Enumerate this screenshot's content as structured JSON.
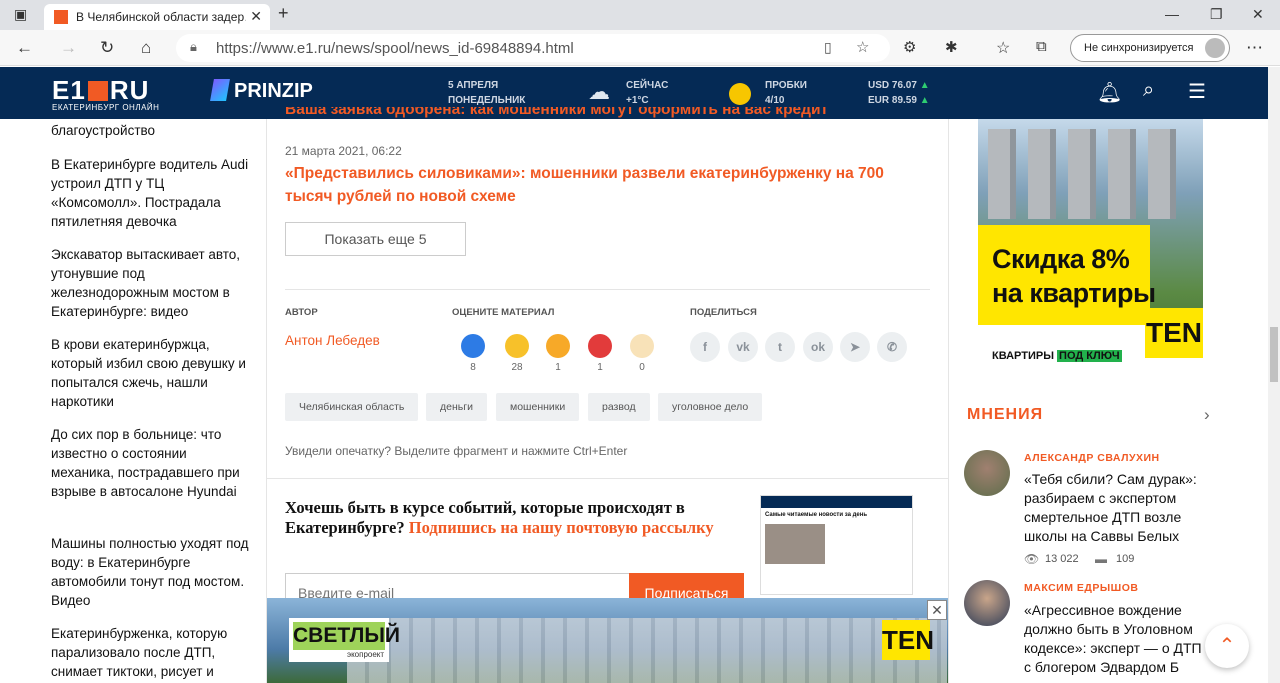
{
  "browser": {
    "tab_title": "В Челябинской области задер…",
    "url": "https://www.e1.ru/news/spool/news_id-69848894.html",
    "sync_label": "Не синхронизируется"
  },
  "site_header": {
    "logo": "E1",
    "logo_ru": "RU",
    "logo_sub": "ЕКАТЕРИНБУРГ ОНЛАЙН",
    "prinzip": "PRINZIP",
    "date_line1": "5 АПРЕЛЯ",
    "date_line2": "ПОНЕДЕЛЬНИК",
    "weather_label": "СЕЙЧАС",
    "weather_value": "+1°C",
    "traffic_label": "ПРОБКИ",
    "traffic_value": "4/10",
    "usd": "USD 76.07",
    "eur": "EUR 89.59"
  },
  "left_news": [
    "благоустройство",
    "В Екатеринбурге водитель Audi устроил ДТП у ТЦ «Комсомолл». Пострадала пятилетняя девочка",
    "Экскаватор вытаскивает авто, утонувшие под железнодорожным мостом в Екатеринбурге: видео",
    "В крови екатеринбуржца, который избил свою девушку и попытался сжечь, нашли наркотики",
    "До сих пор в больнице: что известно о состоянии механика, пострадавшего при взрыве в автосалоне Hyundai",
    "Машины полностью уходят под воду: в Екатеринбурге автомобили тонут под мостом. Видео",
    "Екатеринбурженка, которую парализовало после ДТП, снимает тиктоки, рисует и"
  ],
  "main": {
    "cut_headline": "Ваша заявка одобрена: как мошенники могут оформить на вас кредит",
    "news_date": "21 марта 2021, 06:22",
    "news_title": "«Представились силовиками»: мошенники развели екатеринбурженку на 700 тысяч рублей по новой схеме",
    "more_button": "Показать еще 5",
    "author_label": "АВТОР",
    "author_name": "Антон Лебедев",
    "rate_label": "ОЦЕНИТЕ МАТЕРИАЛ",
    "share_label": "ПОДЕЛИТЬСЯ",
    "reactions": [
      "8",
      "28",
      "1",
      "1",
      "0"
    ],
    "tags": [
      "Челябинская область",
      "деньги",
      "мошенники",
      "развод",
      "уголовное дело"
    ],
    "typo_hint": "Увидели опечатку? Выделите фрагмент и нажмите Ctrl+Enter",
    "subscribe_title": "Хочешь быть в курсе событий, которые происходят в Екатеринбурге? ",
    "subscribe_accent": "Подпишись на нашу почтовую рассылку",
    "email_placeholder": "Введите e-mail",
    "subscribe_button": "Подписаться",
    "mail_preview_heading": "Самые читаемые новости за день"
  },
  "banner": {
    "brand": "СВЕТЛЫЙ",
    "brand_sub": "экопроект",
    "ten": "TEN"
  },
  "right": {
    "ad_title": "Скидка 8%\nна квартиры",
    "ad_ten": "TEN",
    "ad_foot_a": "КВАРТИРЫ ",
    "ad_foot_b": "ПОД КЛЮЧ",
    "opinions_title": "МНЕНИЯ",
    "opinions": [
      {
        "author": "АЛЕКСАНДР СВАЛУХИН",
        "text": "«Тебя сбили? Сам дурак»: разбираем с экспертом смертельное ДТП возле школы на Саввы Белых",
        "views": "13 022",
        "comments": "109"
      },
      {
        "author": "МАКСИМ ЕДРЫШОВ",
        "text": "«Агрессивное вождение должно быть в Уголовном кодексе»: эксперт — о ДТП с блогером Эдвардом Б"
      }
    ]
  },
  "colors": {
    "accent": "#f15a24",
    "header_bg": "#052a55"
  }
}
